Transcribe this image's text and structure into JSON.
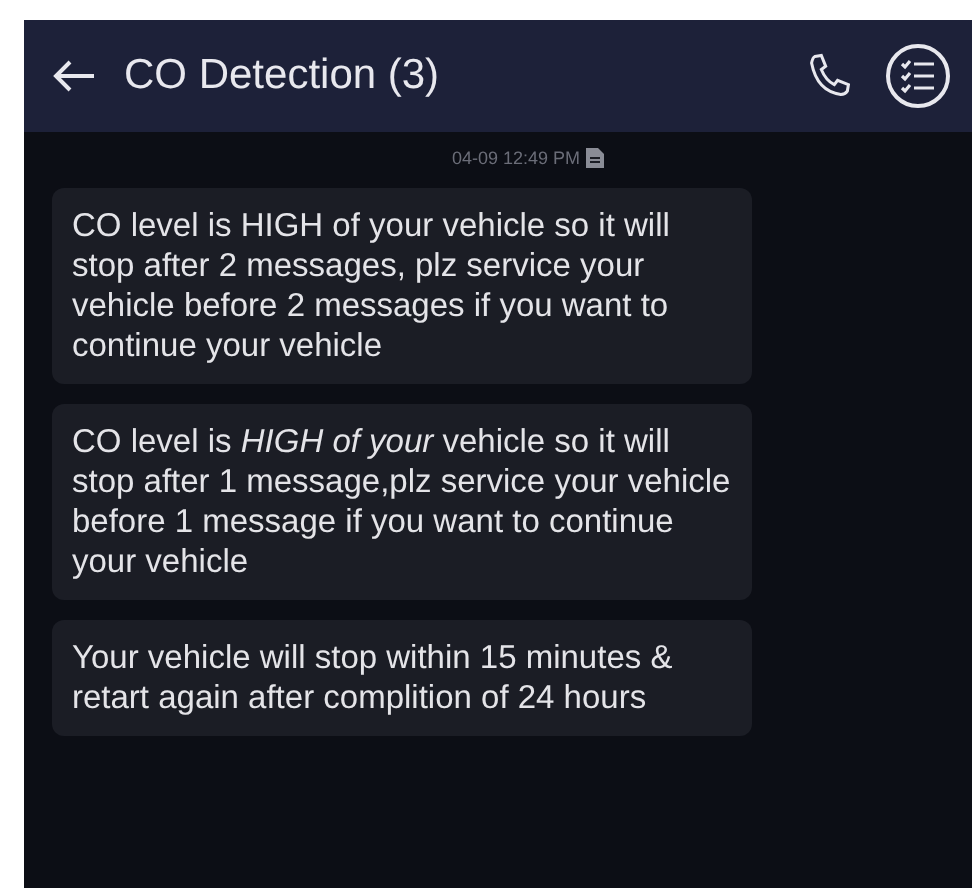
{
  "header": {
    "title": "CO Detection (3)"
  },
  "timestamp": "04-09 12:49 PM",
  "messages": [
    {
      "text": "CO level is HIGH of your vehicle so it will  stop after 2 messages, plz service your vehicle before 2 messages if you want to continue your vehicle"
    },
    {
      "text": "CO level is *HIGH of your* vehicle so it will  stop after 1 message,plz service your vehicle before 1 message if you want to continue your vehicle"
    },
    {
      "text": "Your vehicle will stop within 15 minutes & retart again after complition of 24 hours"
    }
  ]
}
